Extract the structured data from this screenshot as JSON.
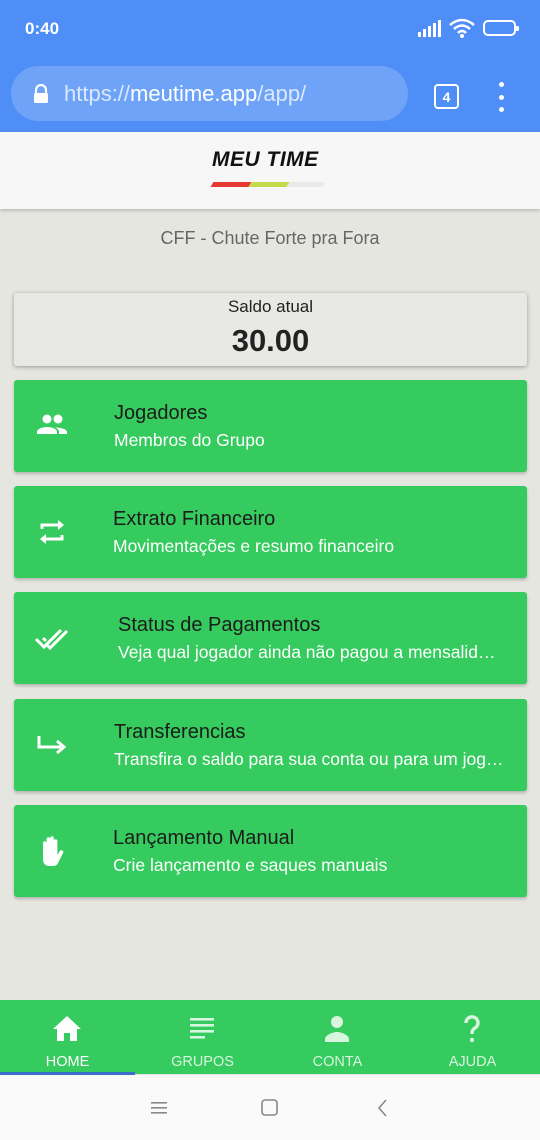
{
  "status_bar": {
    "time": "0:40",
    "battery_icon": "battery-icon",
    "wifi_icon": "wifi-icon",
    "signal_icon": "signal-icon"
  },
  "browser": {
    "url_scheme": "https://",
    "url_host": "meutime.app",
    "url_path": "/app/",
    "tab_count": "4",
    "lock_icon": "lock-icon",
    "menu_icon": "more-vert-icon"
  },
  "header": {
    "logo_text": "MEU TIME",
    "stripe_colors": [
      "#e53935",
      "#c6d94a",
      "#eaeaea"
    ]
  },
  "group": {
    "name": "CFF - Chute Forte pra Fora"
  },
  "balance": {
    "label": "Saldo atual",
    "value": "30.00"
  },
  "menu": [
    {
      "icon": "people-icon",
      "title": "Jogadores",
      "subtitle": "Membros do Grupo"
    },
    {
      "icon": "repeat-icon",
      "title": "Extrato Financeiro",
      "subtitle": "Movimentações e resumo financeiro"
    },
    {
      "icon": "done-all-icon",
      "title": "Status de Pagamentos",
      "subtitle": "Veja qual jogador ainda não pagou a mensalidade"
    },
    {
      "icon": "subdirectory-arrow-icon",
      "title": "Transferencias",
      "subtitle": "Transfira o saldo para sua conta ou para um jogador"
    },
    {
      "icon": "hand-icon",
      "title": "Lançamento Manual",
      "subtitle": "Crie lançamento e saques manuais"
    }
  ],
  "bottom_nav": {
    "active_index": 0,
    "items": [
      {
        "label": "HOME",
        "icon": "home-icon"
      },
      {
        "label": "GRUPOS",
        "icon": "list-icon"
      },
      {
        "label": "CONTA",
        "icon": "person-icon"
      },
      {
        "label": "AJUDA",
        "icon": "help-icon"
      }
    ]
  },
  "colors": {
    "primary": "#4f8ef7",
    "green": "#35cb5e",
    "background": "#e6e6e1",
    "active_indicator": "#3b6fcc"
  }
}
